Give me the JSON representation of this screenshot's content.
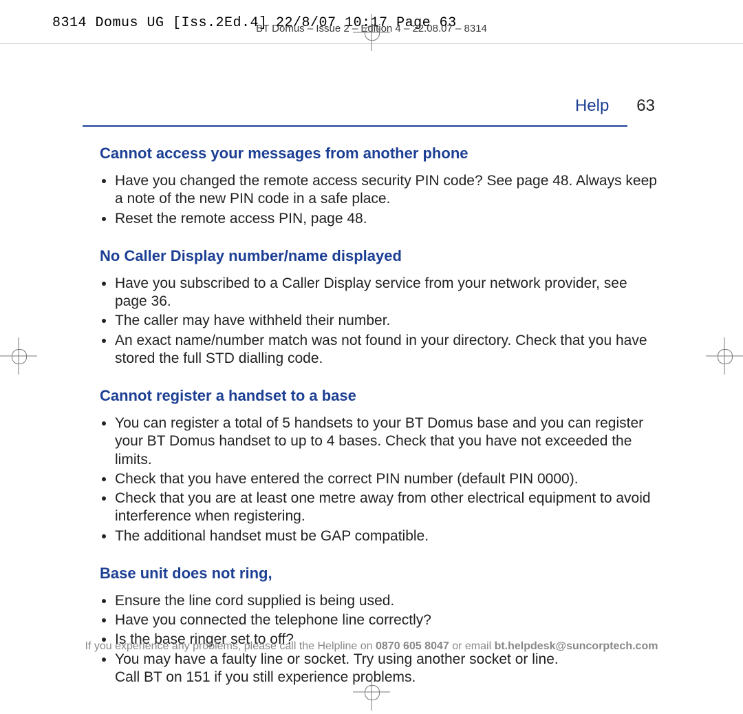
{
  "slug": "8314 Domus UG [Iss.2Ed.4]  22/8/07  10:17  Page 63",
  "runhead": "BT Domus – Issue 2 – Edition 4 – 22.08.07 – 8314",
  "header": {
    "section": "Help",
    "page_number": "63"
  },
  "sections": [
    {
      "title": "Cannot access your messages from another phone",
      "items": [
        "Have you changed the remote access security PIN code? See page 48. Always keep a note of the new PIN code in a safe place.",
        "Reset the remote access PIN, page 48."
      ]
    },
    {
      "title": "No Caller Display number/name displayed",
      "items": [
        "Have you subscribed to a Caller Display service from your network provider, see page 36.",
        "The caller may have withheld their number.",
        "An exact name/number match was not found in your directory. Check that you have stored the full STD dialling code."
      ]
    },
    {
      "title": "Cannot register a handset to a base",
      "items": [
        "You can register a total of 5 handsets to your BT Domus base and you can register your BT Domus handset to up to 4 bases. Check that you have not exceeded the limits.",
        "Check that you have entered the correct PIN number (default PIN 0000).",
        "Check that you are at least one metre away from other electrical equipment to avoid interference when registering.",
        "The additional handset must be GAP compatible."
      ]
    },
    {
      "title": "Base unit does not ring,",
      "items": [
        "Ensure the line cord supplied is being used.",
        "Have you connected the telephone line correctly?",
        "Is the base ringer set to off?",
        "You may have a faulty line or socket. Try using another socket or line."
      ],
      "trailing": "Call BT on 151 if you still experience problems."
    }
  ],
  "footnote": {
    "pre": "If you experience any problems, please call the Helpline on ",
    "phone": "0870 605 8047",
    "mid": " or email ",
    "email": "bt.helpdesk@suncorptech.com"
  }
}
